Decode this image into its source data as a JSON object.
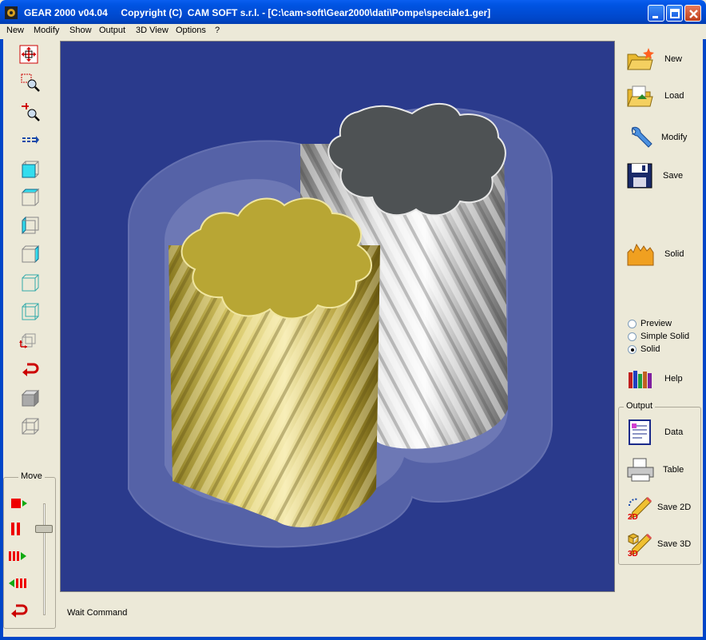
{
  "window": {
    "title": "GEAR 2000 v04.04     Copyright (C)  CAM SOFT s.r.l. - [C:\\cam-soft\\Gear2000\\dati\\Pompe\\speciale1.ger]",
    "icon": "gear-app-icon",
    "controls": [
      "minimize",
      "maximize",
      "close"
    ]
  },
  "menu": [
    "New",
    "Modify",
    "Show",
    "Output",
    "3D View",
    "Options",
    "?"
  ],
  "left_toolbar": {
    "tools": [
      "pan-icon",
      "zoom-window-icon",
      "zoom-icon",
      "next-icon",
      "view-front-icon",
      "view-top-icon",
      "view-left-icon",
      "view-right-icon",
      "view-iso-1-icon",
      "view-iso-2-icon",
      "axes-icon",
      "undo-view-icon",
      "shaded-cube-icon",
      "wire-cube-icon"
    ],
    "move": {
      "caption": "Move",
      "buttons": [
        "play-icon",
        "pause-icon",
        "forward-icon",
        "reverse-icon",
        "return-icon"
      ],
      "slider_level": 0.15
    }
  },
  "status": "Wait Command",
  "right_panel": {
    "buttons": [
      {
        "label": "New",
        "icon": "new-folder-icon"
      },
      {
        "label": "Load",
        "icon": "load-folder-icon"
      },
      {
        "label": "Modify",
        "icon": "wrench-icon"
      },
      {
        "label": "Save",
        "icon": "floppy-icon"
      },
      {
        "label": "Solid",
        "icon": "solid-gear-icon"
      }
    ],
    "render_mode": [
      {
        "label": "Preview",
        "checked": false
      },
      {
        "label": "Simple Solid",
        "checked": false
      },
      {
        "label": "Solid",
        "checked": true
      }
    ],
    "help_label": "Help",
    "output": {
      "caption": "Output",
      "buttons": [
        {
          "label": "Data",
          "icon": "data-sheet-icon"
        },
        {
          "label": "Table",
          "icon": "printer-icon"
        },
        {
          "label": "Save 2D",
          "icon": "pencil-2d-icon"
        },
        {
          "label": "Save 3D",
          "icon": "pencil-3d-icon"
        }
      ]
    }
  },
  "colors": {
    "viewport_bg": "#2a3a8c",
    "gear_gold": "#c8b43c",
    "gear_silver": "#a8a8a8",
    "titlebar": "#0054e3"
  }
}
